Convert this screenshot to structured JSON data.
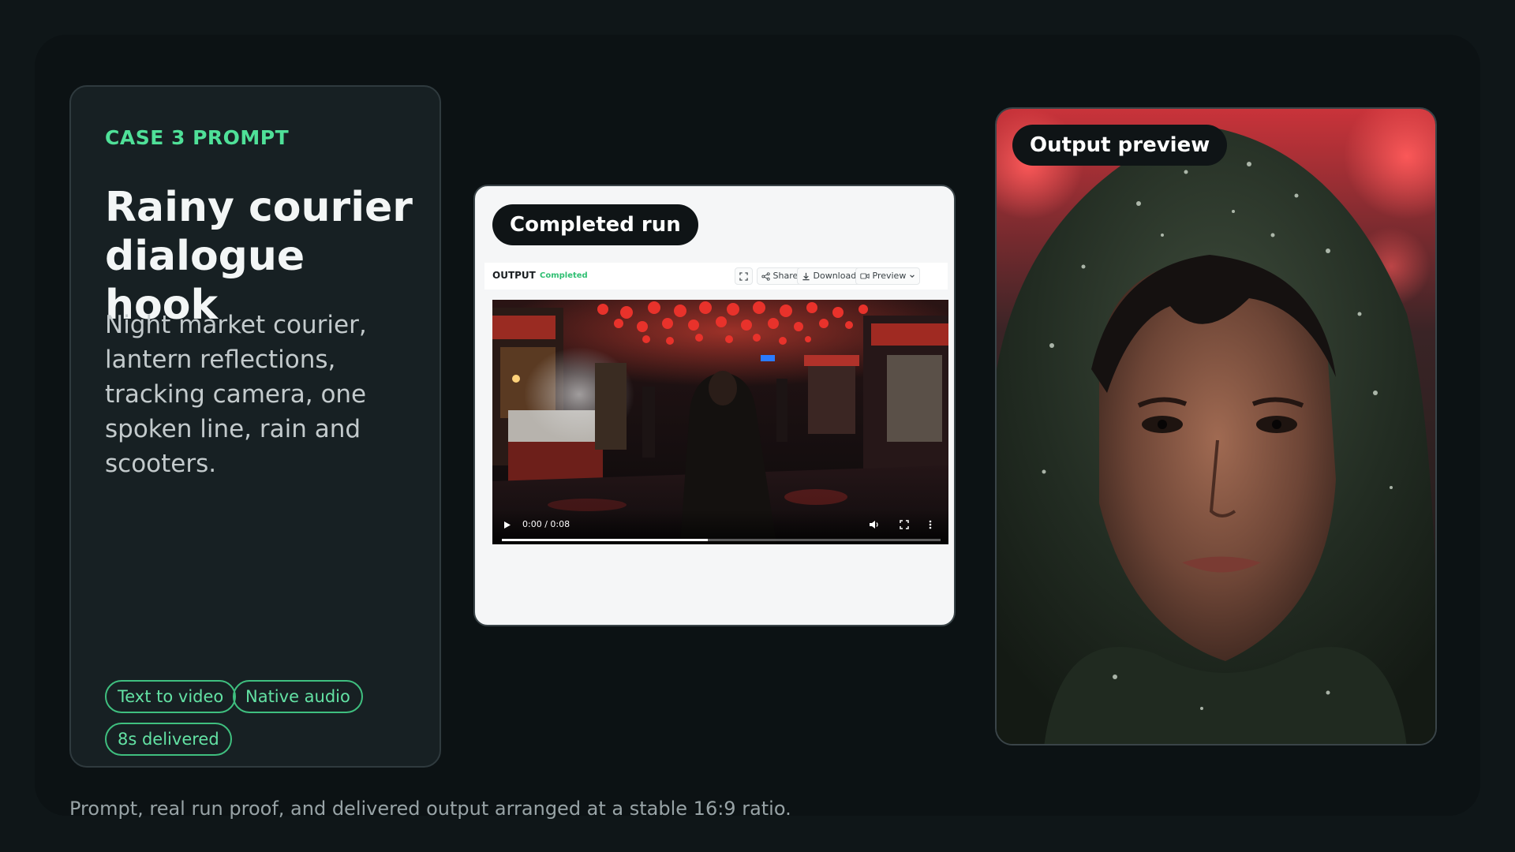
{
  "prompt_card": {
    "case_label": "CASE 3 PROMPT",
    "title": "Rainy courier dialogue hook",
    "description": "Night market courier, lantern reflections, tracking camera, one spoken line, rain and scooters.",
    "chips": [
      "Text to video",
      "Native audio",
      "8s delivered"
    ]
  },
  "run_panel": {
    "badge": "Completed run",
    "output_label": "OUTPUT",
    "status": "Completed",
    "share_label": "Share",
    "download_label": "Download",
    "preview_label": "Preview",
    "video": {
      "time": "0:00 / 0:08",
      "progress": 0.47
    }
  },
  "preview": {
    "badge": "Output preview"
  },
  "caption": "Prompt, real run proof, and delivered output arranged at a stable 16:9 ratio.",
  "colors": {
    "accent_green": "#4fe098",
    "page_bg": "#0f1618",
    "card_bg": "#172023"
  }
}
